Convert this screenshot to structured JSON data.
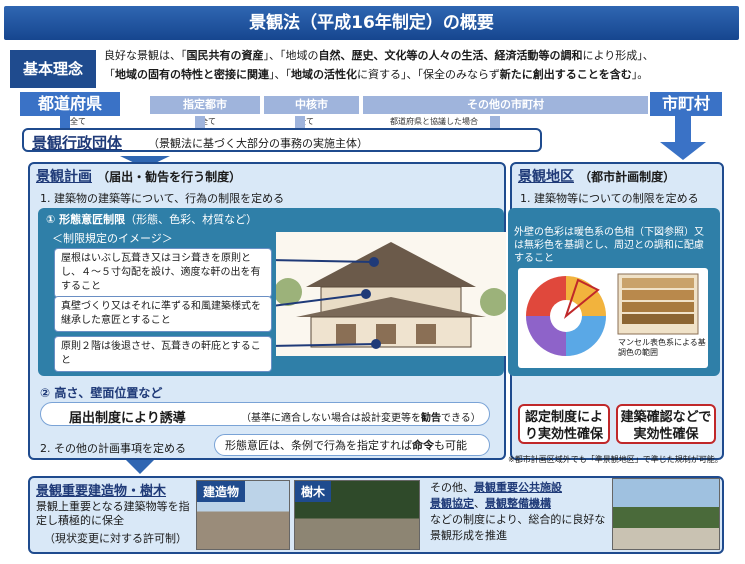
{
  "title": "景観法（平成16年制定）の概要",
  "kihon": {
    "label": "基本理念",
    "line1_a": "良好な景観は、「",
    "line1_b": "国民共有の資産",
    "line1_c": "」、「地域の",
    "line1_d": "自然、歴史、文化等の人々の生活、経済活動等の調和",
    "line1_e": "により形成」、",
    "line2_a": "「",
    "line2_b": "地域の固有の特性と密接に関連",
    "line2_c": "」、「",
    "line2_d": "地域の活性化",
    "line2_e": "に資する」、「保全のみならず",
    "line2_f": "新たに創出することを含む",
    "line2_g": "」。"
  },
  "levels": {
    "todofuken": "都道府県",
    "shitei": "指定都市",
    "chukaku": "中核市",
    "sonota": "その他の市町村",
    "shichoson": "市町村",
    "zen1": "全て",
    "zen2": "全て",
    "zen3": "全て",
    "kyogi": "都道府県と協議した場合"
  },
  "gyosei": {
    "title": "景観行政団体",
    "sub": "（景観法に基づく大部分の事務の実施主体）"
  },
  "keikaku": {
    "title": "景観計画",
    "title_sub": "（届出・勧告を行う制度）",
    "item1": "1. 建築物の建築等について、行為の制限を定める",
    "sub1": "① 形態意匠制限",
    "sub1_paren": "（形態、色彩、材質など）",
    "image_caption": "＜制限規定のイメージ＞",
    "note1": "屋根はいぶし瓦葺き又はヨシ葺きを原則とし、４～５寸勾配を設け、適度な軒の出を有すること",
    "note2": "真壁づくり又はそれに準ずる和風建築様式を継承した意匠とすること",
    "note3": "原則２階は後退させ、瓦葺きの軒庇とすること",
    "note_right": "外壁の色彩は暖色系の色相（下図参照）又は無彩色を基調とし、周辺との調和に配慮すること",
    "munsell": "マンセル表色系による基調色の範囲",
    "sub2": "② 高さ、壁面位置など",
    "todoke": "届出制度により誘導",
    "todoke_sub_a": "（基準に適合しない場合は設計変更等を",
    "todoke_sub_b": "勧告",
    "todoke_sub_c": "できる）",
    "item2": "2. その他の計画事項を定める",
    "meirei_a": "形態意匠は、条例で行為を指定すれば",
    "meirei_b": "命令",
    "meirei_c": "も可能"
  },
  "chiku": {
    "title": "景観地区",
    "title_sub": "（都市計画制度）",
    "item1": "1. 建築物等についての制限を定める",
    "nintei": "認定制度により実効性確保",
    "kakunin": "建築確認などで実効性確保",
    "footnote": "※都市計画区域外でも「準景観地区」で準じた規制が可能。"
  },
  "bottom": {
    "title": "景観重要建造物・樹木",
    "tag_kenzo": "建造物",
    "tag_jumoku": "樹木",
    "text1": "景観上重要となる建築物等を指定し積極的に保全",
    "text2": "（現状変更に対する許可制）",
    "other_a": "その他、",
    "other_b": "景観重要公共施設",
    "other_c": "景観協定",
    "other_sep": "、",
    "other_d": "景観整備機構",
    "other_e": "などの制度により、総合的に良好な景観形成を推進"
  },
  "colors": {
    "title_blue": "#16468f",
    "accent_blue": "#3a72c6",
    "red": "#c0282a"
  }
}
